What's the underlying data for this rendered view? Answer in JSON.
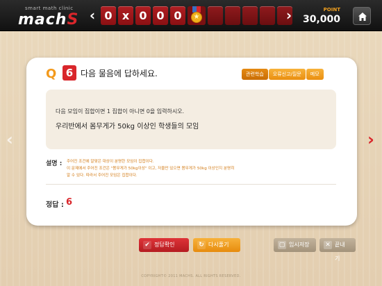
{
  "brand": {
    "subtitle": "smart math clinic",
    "name": "mach",
    "name_accent": "S"
  },
  "progress": {
    "prev_icon": "chevron-left-icon",
    "next_icon": "chevron-right-icon",
    "cells": [
      "0",
      "x",
      "0",
      "0",
      "0"
    ],
    "medal_icon": "medal-star-icon",
    "empty_cells": 5
  },
  "points": {
    "label": "POINT",
    "value": "30,000"
  },
  "home_icon": "home-icon",
  "question": {
    "prefix": "Q",
    "number": "6",
    "title": "다음 물음에 답하세요.",
    "tabs": [
      "관련학습",
      "오류신고/질문",
      "메모"
    ],
    "instruction": "다음 모임이 집합이면 1 집합이 아니면 0을 입력하시오.",
    "problem": "우리반에서 몸무게가 50kg 이상인 학생들의 모임",
    "explanation_label": "설명 :",
    "explanation_lines": [
      "주어진 조건에 알맞은 대상이 분명한 모임이 집합이다.",
      "이 문제에서 주어진 조건은 \"몸무게가 50kg이상\" 이고, 저울만 있으면 몸무게가 50kg 이상인지 분명히",
      "알 수 있다. 따라서 주어진 모임은 집합이다."
    ],
    "answer_label": "정답 :",
    "answer_value": "6"
  },
  "buttons": {
    "check": "정답확인",
    "retry": "다시풀기",
    "save": "임시저장",
    "close": "끝내기"
  },
  "copyright": "COPYRIGHT© 2011 MACHS. ALL RIGHTS RESERVED.",
  "colors": {
    "accent_red": "#d9262b",
    "accent_orange": "#f39a1c",
    "topbar": "#1a1a1a"
  }
}
